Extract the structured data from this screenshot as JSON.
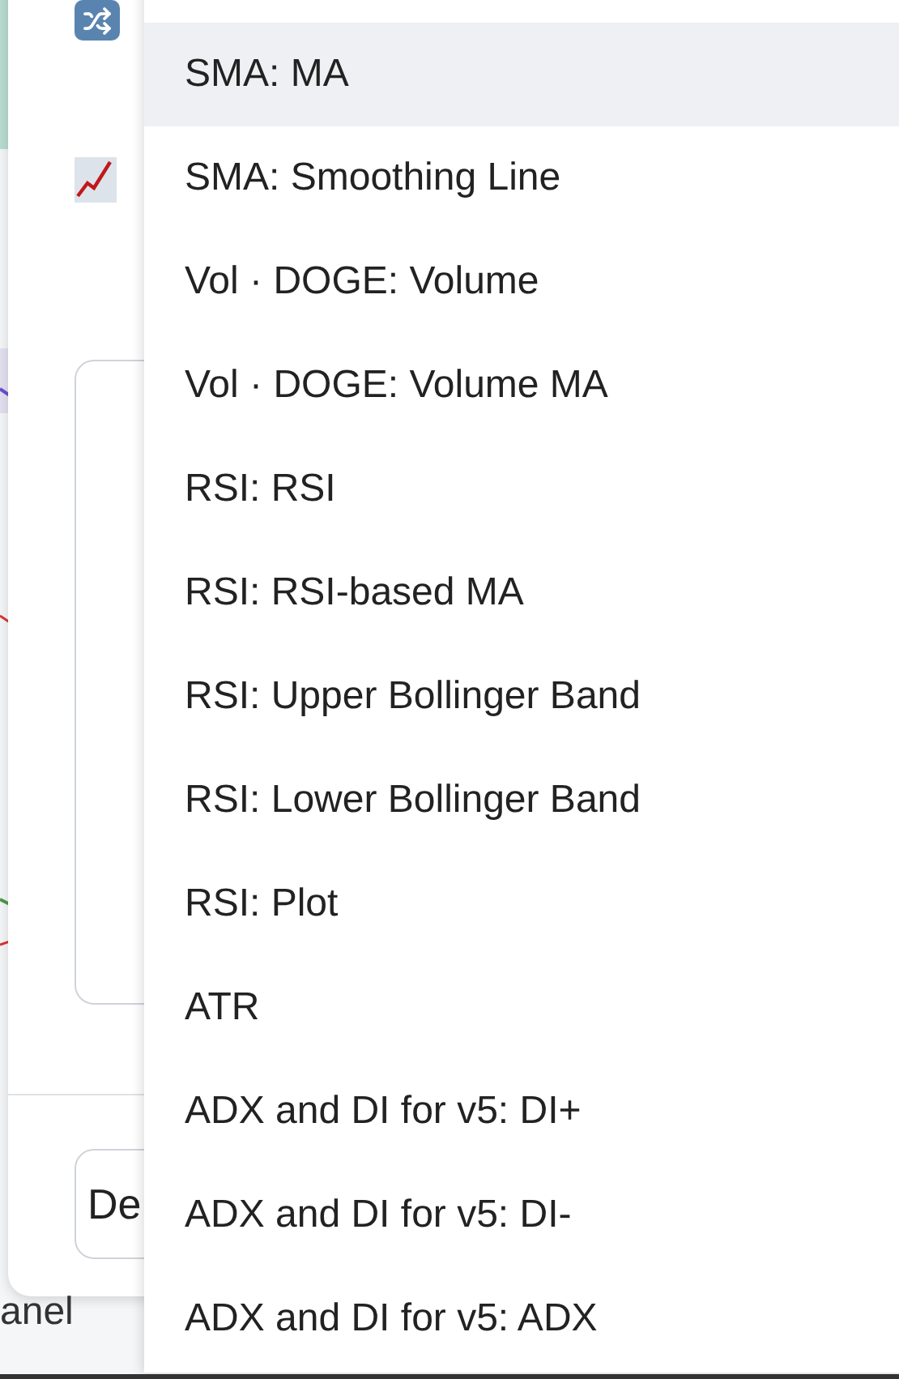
{
  "background": {
    "dialog": {
      "button_text": "De"
    },
    "footer_text": "anel"
  },
  "menu": {
    "items": [
      {
        "label": "SMA: MA",
        "selected": true
      },
      {
        "label": "SMA: Smoothing Line",
        "selected": false
      },
      {
        "label": "Vol · DOGE: Volume",
        "selected": false
      },
      {
        "label": "Vol · DOGE: Volume MA",
        "selected": false
      },
      {
        "label": "RSI: RSI",
        "selected": false
      },
      {
        "label": "RSI: RSI-based MA",
        "selected": false
      },
      {
        "label": "RSI: Upper Bollinger Band",
        "selected": false
      },
      {
        "label": "RSI: Lower Bollinger Band",
        "selected": false
      },
      {
        "label": "RSI: Plot",
        "selected": false
      },
      {
        "label": "ATR",
        "selected": false
      },
      {
        "label": "ADX and DI for v5: DI+",
        "selected": false
      },
      {
        "label": "ADX and DI for v5: DI-",
        "selected": false
      },
      {
        "label": "ADX and DI for v5: ADX",
        "selected": false
      }
    ]
  }
}
